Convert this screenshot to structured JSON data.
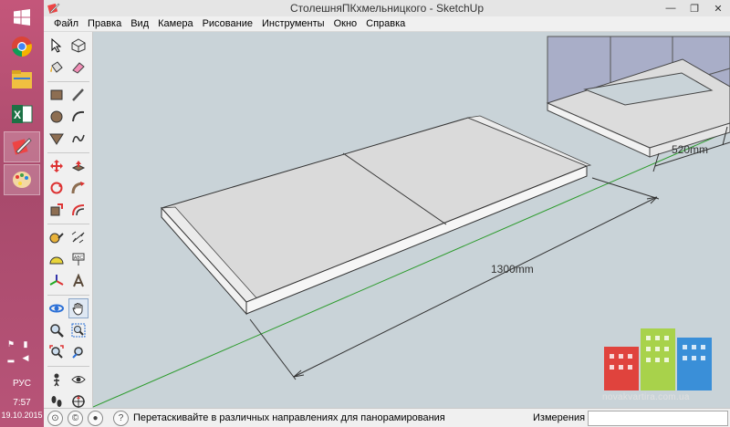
{
  "window": {
    "title": "СтолешняПКхмельницкого - SketchUp",
    "minimize": "—",
    "maximize": "❐",
    "close": "✕"
  },
  "menu": [
    "Файл",
    "Правка",
    "Вид",
    "Камера",
    "Рисование",
    "Инструменты",
    "Окно",
    "Справка"
  ],
  "taskbar": {
    "language": "РУС",
    "time": "7:57",
    "date": "19.10.2015",
    "apps": [
      "windows-start-icon",
      "chrome-icon",
      "file-explorer-icon",
      "excel-icon",
      "sketchup-icon",
      "paint-icon"
    ]
  },
  "tools": [
    "select-arrow-icon",
    "make-component-icon",
    "paint-bucket-icon",
    "eraser-icon",
    "rectangle-icon",
    "line-icon",
    "circle-icon",
    "arc-icon",
    "polygon-icon",
    "freehand-icon",
    "move-icon",
    "push-pull-icon",
    "rotate-icon",
    "follow-me-icon",
    "scale-icon",
    "offset-icon",
    "tape-measure-icon",
    "dimension-icon",
    "protractor-icon",
    "text-icon",
    "axes-icon",
    "3d-text-icon",
    "orbit-icon",
    "pan-icon",
    "zoom-icon",
    "zoom-window-icon",
    "zoom-extents-icon",
    "previous-view-icon",
    "position-camera-icon",
    "look-around-icon",
    "walk-icon",
    "section-plane-icon"
  ],
  "viewport": {
    "dimension_length": "1300mm",
    "dimension_width": "520mm",
    "axis_green": "#2a9a2a",
    "background": "#c9d3d8"
  },
  "watermark": {
    "url": "novakvartira.com.ua",
    "colors": [
      "#e0433d",
      "#a8d24b",
      "#3a8fd8"
    ]
  },
  "status": {
    "message": "Перетаскивайте в различных направлениях для панорамирования",
    "measure_label": "Измерения",
    "measure_value": ""
  }
}
